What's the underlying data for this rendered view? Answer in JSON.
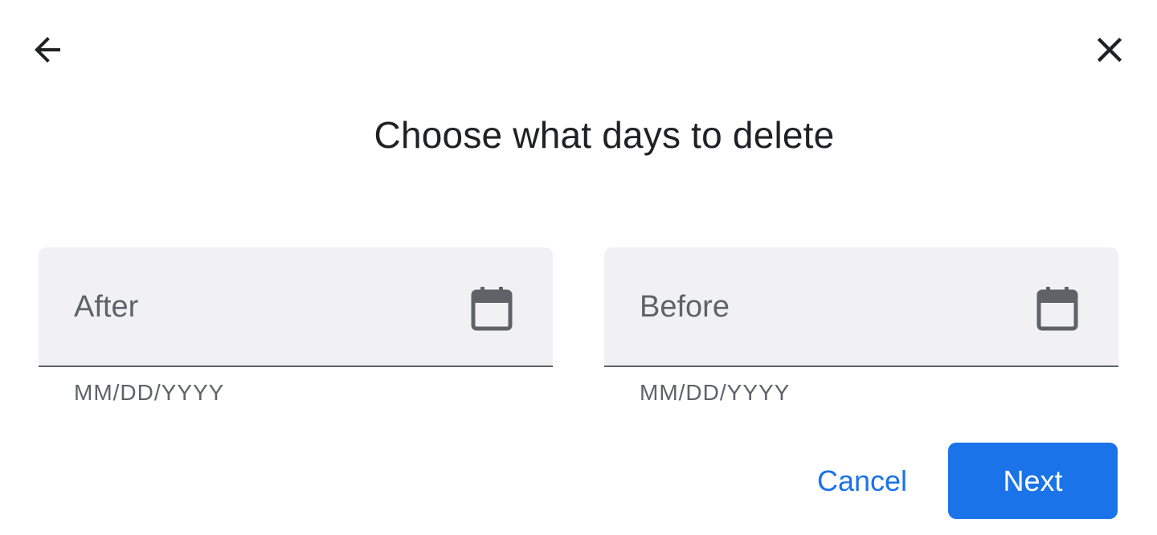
{
  "dialog": {
    "title": "Choose what days to delete"
  },
  "header": {
    "back_icon": "arrow-back-icon",
    "close_icon": "close-icon"
  },
  "fields": {
    "after": {
      "label": "After",
      "helper": "MM/DD/YYYY",
      "icon": "calendar-icon"
    },
    "before": {
      "label": "Before",
      "helper": "MM/DD/YYYY",
      "icon": "calendar-icon"
    }
  },
  "actions": {
    "cancel_label": "Cancel",
    "next_label": "Next"
  },
  "colors": {
    "accent": "#1a73e8",
    "field_bg": "#f1f1f3",
    "text_primary": "#202124",
    "text_secondary": "#5f6368"
  }
}
